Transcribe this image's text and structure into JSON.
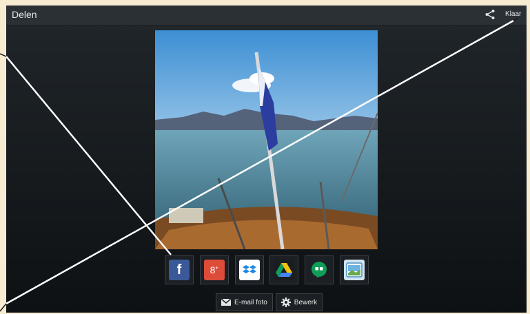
{
  "app": {
    "title": "Delen"
  },
  "toolbar": {
    "share_icon": "share-icon",
    "done_label": "Klaar"
  },
  "share_targets": [
    {
      "name": "facebook",
      "icon": "facebook-icon",
      "color": "#3b5998"
    },
    {
      "name": "google-plus",
      "icon": "google-plus-icon",
      "color": "#dd4b39"
    },
    {
      "name": "dropbox",
      "icon": "dropbox-icon",
      "color": "#1e88e5"
    },
    {
      "name": "google-drive",
      "icon": "google-drive-icon",
      "color": "#1a1d1f"
    },
    {
      "name": "hangouts",
      "icon": "hangouts-icon",
      "color": "#0f9d58"
    },
    {
      "name": "gallery",
      "icon": "gallery-icon",
      "color": "#4a90c2"
    }
  ],
  "actions": {
    "email_label": "E-mail foto",
    "edit_label": "Bewerk"
  }
}
